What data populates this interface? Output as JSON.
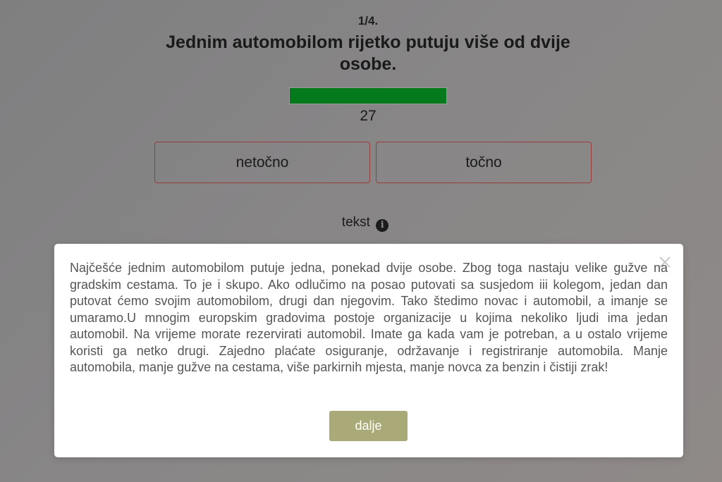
{
  "quiz": {
    "counter": "1/4.",
    "question": "Jednim automobilom rijetko putuju više od dvije osobe.",
    "progress_fraction": 1.0,
    "progress_color": "#047a1d",
    "timer": "27",
    "answers": {
      "false_label": "netočno",
      "true_label": "točno"
    },
    "text_link": {
      "label": "tekst",
      "icon": "info-circle-icon"
    }
  },
  "modal": {
    "close_icon": "close-icon",
    "body": "Najčešće jednim automobilom putuje jedna, ponekad dvije osobe. Zbog toga nastaju velike gužve na gradskim cestama. To je i skupo. Ako odlučimo na posao putovati sa susjedom iii kolegom, jedan dan putovat ćemo svojim automobilom, drugi dan njegovim. Tako štedimo novac i automobil, a imanje se umaramo.U mnogim europskim gradovima postoje organizacije u kojima nekoliko ljudi ima jedan automobil. Na vrijeme morate rezervirati automobil. Imate ga kada vam je potreban, a u ostalo vrijeme koristi ga netko drugi. Zajedno plaćate osiguranje, održavanje i registriranje automobila. Manje automobila, manje gužve na cestama, više parkirnih mjesta, manje novca za benzin i čistiji zrak!",
    "next_label": "dalje",
    "next_color": "#a9aa78"
  }
}
